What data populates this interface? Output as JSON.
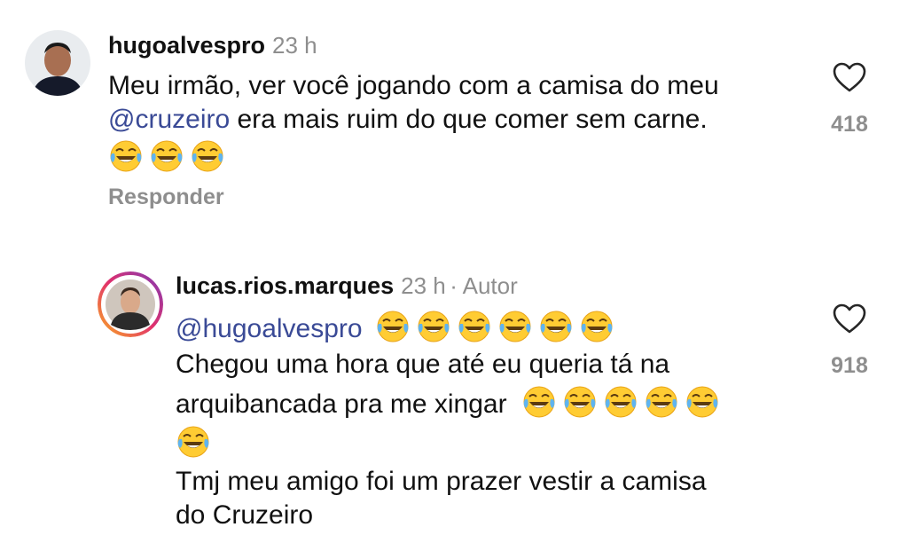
{
  "comment1": {
    "username": "hugoalvespro",
    "time": "23 h",
    "text_part1": "Meu irmão, ver você jogando com a camisa do meu",
    "mention": "@cruzeiro",
    "text_part2": " era mais ruim do que comer sem carne.",
    "emoji_count": 3,
    "reply_label": "Responder",
    "likes": "418",
    "icons": {
      "like": "heart-outline-icon",
      "emoji": "face-with-tears-of-joy"
    }
  },
  "comment2": {
    "username": "lucas.rios.marques",
    "time": "23 h",
    "author_tag": "· Autor",
    "mention": "@hugoalvespro",
    "line2": "Chegou uma hora que até eu queria tá na",
    "line3": "arquibancada pra me xingar",
    "line5": "Tmj meu amigo foi um prazer vestir a camisa",
    "line6": "do Cruzeiro",
    "likes": "918",
    "icons": {
      "like": "heart-outline-icon",
      "emoji": "face-with-tears-of-joy"
    }
  },
  "colors": {
    "mention": "#3a4a96",
    "secondary": "#8e8e8e",
    "story_ring": [
      "#f9a825",
      "#e1306c",
      "#833ab4"
    ]
  }
}
